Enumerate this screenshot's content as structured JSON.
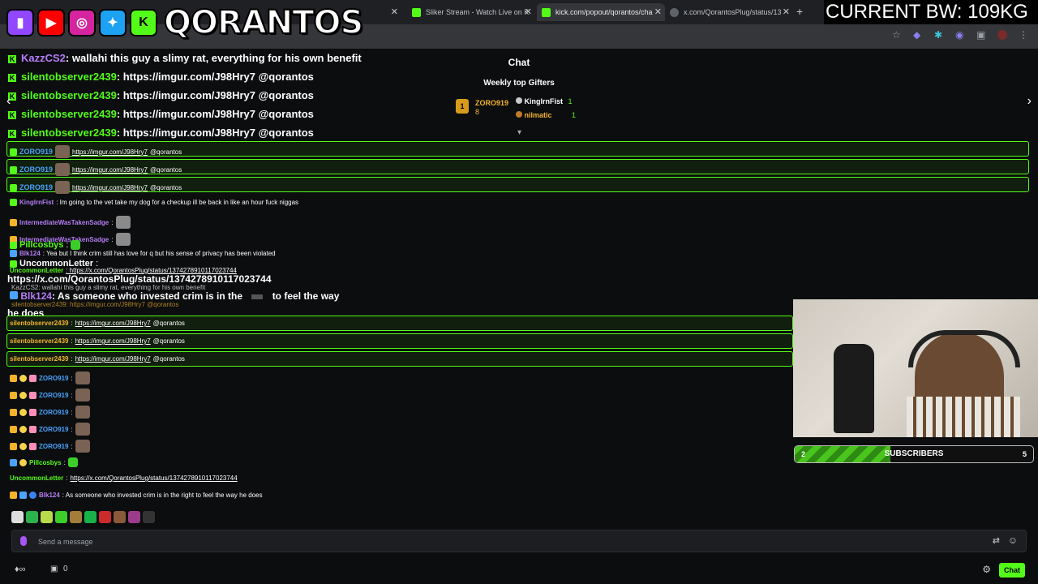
{
  "browser": {
    "tabs": [
      {
        "title": "tch",
        "favicon_color": "#35363a"
      },
      {
        "title": "Sliker Stream - Watch Live on K",
        "favicon_color": "#53fc18"
      },
      {
        "title": "kick.com/popout/qorantos/cha",
        "favicon_color": "#53fc18"
      },
      {
        "title": "x.com/QorantosPlug/status/13",
        "favicon_color": "#5f6368"
      }
    ],
    "new_tab_icon": "plus-icon"
  },
  "overlay": {
    "brand": "QORANTOS",
    "social_icons": [
      "twitch-icon",
      "youtube-icon",
      "instagram-icon",
      "twitter-icon",
      "kick-icon"
    ],
    "bw_label": "CURRENT BW: 109KG"
  },
  "chat": {
    "title": "Chat",
    "weekly_title": "Weekly top Gifters",
    "gifters": [
      {
        "rank": "1",
        "name": "ZORO919",
        "count": "8"
      },
      {
        "rank": "2",
        "name": "KinglrnFist",
        "count": "1"
      },
      {
        "rank": "3",
        "name": "nilmatic",
        "count": "1"
      }
    ],
    "big_messages": [
      {
        "user": "KazzCS2",
        "text": ": wallahi this guy a slimy rat, everything for his own benefit",
        "color": "#b77df7"
      },
      {
        "user": "silentobserver2439",
        "text": ": https://imgur.com/J98Hry7 @qorantos",
        "color": "#53fc18"
      },
      {
        "user": "silentobserver2439",
        "text": ": https://imgur.com/J98Hry7 @qorantos",
        "color": "#53fc18"
      },
      {
        "user": "silentobserver2439",
        "text": ": https://imgur.com/J98Hry7 @qorantos",
        "color": "#53fc18"
      },
      {
        "user": "silentobserver2439",
        "text": ": https://imgur.com/J98Hry7 @qorantos",
        "color": "#53fc18"
      }
    ],
    "highlight_rows": [
      {
        "user": "ZORO919",
        "link": "https://imgur.com/J98Hry7",
        "text": "@qorantos"
      },
      {
        "user": "ZORO919",
        "link": "https://imgur.com/J98Hry7",
        "text": "@qorantos"
      },
      {
        "user": "ZORO919",
        "link": "https://imgur.com/J98Hry7",
        "text": "@qorantos"
      }
    ],
    "middle_messages": [
      {
        "user": "KinglrnFist",
        "text": ": Im going to the vet take my dog for a checkup ill be back in like an hour fuck niggas"
      },
      {
        "user": "IntermediateWasTakenSadge",
        "text": ":"
      },
      {
        "user": "IntermediateWasTakenSadge",
        "text": ":"
      },
      {
        "user": "Pillcosbys",
        "text": ":"
      },
      {
        "user": "Blk124",
        "text": ": Yea but I think crim still has love for q but his sense of privacy has been violated"
      },
      {
        "user": "UncommonLetter",
        "text": ":"
      },
      {
        "user": "UncommonLetter",
        "text": ": https://x.com/QorantosPlug/status/1374278910117023744"
      }
    ],
    "big_link": "https://x.com/QorantosPlug/status/1374278910117023744",
    "ghost_kazz": "KazzCS2: wallahi this guy a slimy rat, everything for his own benefit",
    "blk_big": {
      "user": "Blk124",
      "text": ": As someone who invested crim is in the",
      "text2": "to feel the way",
      "text3": "he does"
    },
    "ghost_silent": "silentobserver2439: https://imgur.com/J98Hry7 @qorantos",
    "green_rows": [
      {
        "user": "silentobserver2439",
        "link": "https://imgur.com/J98Hry7",
        "text": "@qorantos"
      },
      {
        "user": "silentobserver2439",
        "link": "https://imgur.com/J98Hry7",
        "text": "@qorantos"
      },
      {
        "user": "silentobserver2439",
        "link": "https://imgur.com/J98Hry7",
        "text": "@qorantos"
      }
    ],
    "zoro_rows": [
      "ZORO919",
      "ZORO919",
      "ZORO919",
      "ZORO919",
      "ZORO919"
    ],
    "zoro_suffix": ":",
    "pillcosbys": {
      "user": "Pillcosbys",
      "text": ":"
    },
    "uncommon": {
      "user": "UncommonLetter",
      "text": ":",
      "link": "https://x.com/QorantosPlug/status/1374278910117023744"
    },
    "blk_last": {
      "user": "Blk124",
      "text": ": As someone who invested crim is in the right to feel the way he does"
    },
    "input_placeholder": "Send a message",
    "footer_count": "0",
    "chat_button": "Chat"
  },
  "subscriber_goal": {
    "label": "SUBSCRIBERS",
    "current": "2",
    "goal": "5",
    "progress": 0.4
  },
  "colors": {
    "kick_green": "#53fc18",
    "background": "#0b0d0e",
    "purple": "#b77df7",
    "blue": "#4aa3ff"
  }
}
